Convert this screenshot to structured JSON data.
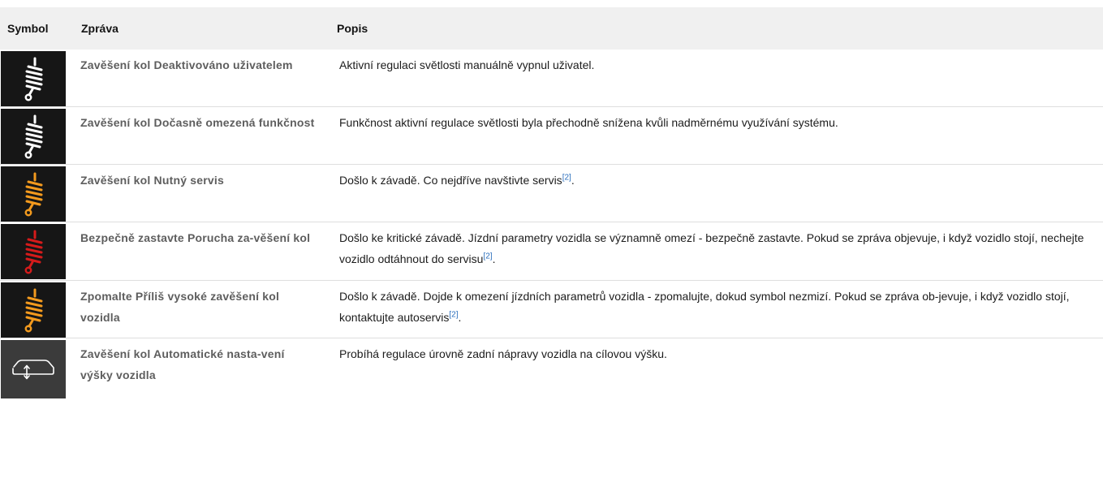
{
  "header": {
    "symbol": "Symbol",
    "message": "Zpráva",
    "description": "Popis"
  },
  "rows": [
    {
      "icon": "suspension-white-icon",
      "icon_color": "#ffffff",
      "message": "Zavěšení kol Deaktivováno uživatelem",
      "description": "Aktivní regulaci světlosti manuálně vypnul uživatel.",
      "ref": ""
    },
    {
      "icon": "suspension-white-icon",
      "icon_color": "#ffffff",
      "message": "Zavěšení kol Dočasně omezená funkčnost",
      "description": "Funkčnost aktivní regulace světlosti byla přechodně snížena kvůli nadměrnému využívání systému.",
      "ref": ""
    },
    {
      "icon": "suspension-orange-icon",
      "icon_color": "#f39a1e",
      "message": "Zavěšení kol Nutný servis",
      "description": "Došlo k závadě. Co nejdříve navštivte servis",
      "ref": "[2]",
      "suffix": "."
    },
    {
      "icon": "suspension-red-icon",
      "icon_color": "#d51b1b",
      "message": "Bezpečně zastavte Porucha za-věšení kol",
      "description": "Došlo ke kritické závadě. Jízdní parametry vozidla se významně omezí - bezpečně zastavte. Pokud se zpráva objevuje, i když vozidlo stojí, nechejte vozidlo odtáhnout do servisu",
      "ref": "[2]",
      "suffix": "."
    },
    {
      "icon": "suspension-orange-icon",
      "icon_color": "#f39a1e",
      "message": "Zpomalte Příliš vysoké zavěšení kol vozidla",
      "description": "Došlo k závadě. Dojde k omezení jízdních parametrů vozidla - zpomalujte, dokud symbol nezmizí. Pokud se zpráva ob-jevuje, i když vozidlo stojí, kontaktujte autoservis",
      "ref": "[2]",
      "suffix": "."
    },
    {
      "icon": "car-level-icon",
      "icon_color": "#ffffff",
      "message": "Zavěšení kol Automatické nasta-vení výšky vozidla",
      "description": "Probíhá regulace úrovně zadní nápravy vozidla na cílovou výšku.",
      "ref": ""
    }
  ]
}
